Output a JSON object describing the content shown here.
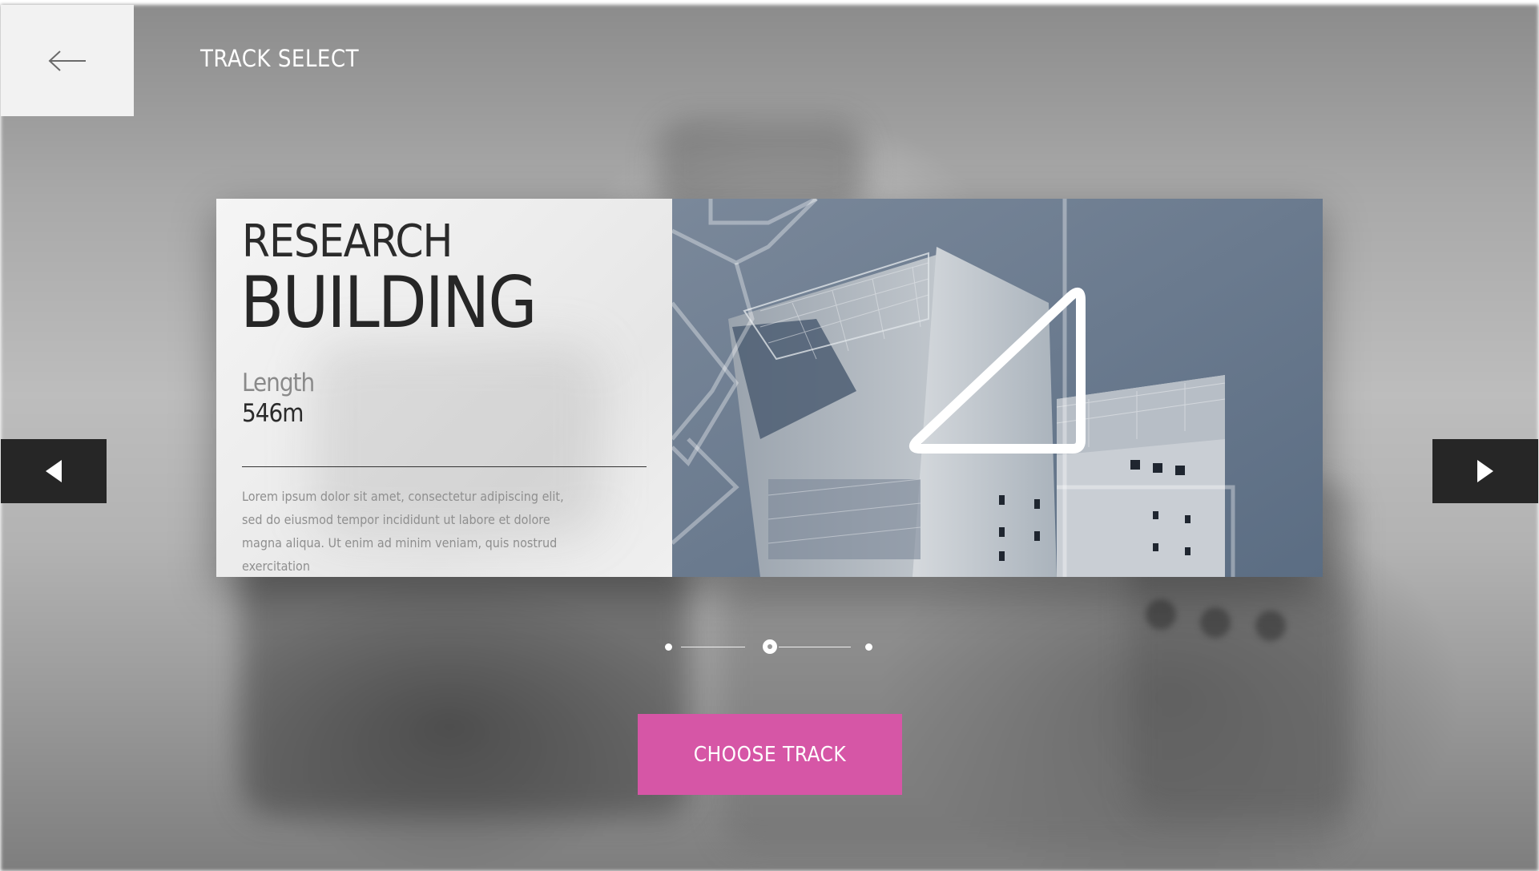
{
  "header": {
    "title": "TRACK SELECT",
    "back_icon": "arrow-left-icon"
  },
  "track": {
    "subtitle": "RESEARCH",
    "name": "BUILDING",
    "length_label": "Length",
    "length_value": "546m",
    "description": "Lorem ipsum dolor sit amet, consectetur adipiscing elit, sed do eiusmod tempor incididunt ut labore et dolore magna aliqua. Ut enim ad minim veniam, quis nostrud exercitation",
    "map_icon": "track-layout-icon"
  },
  "navigation": {
    "prev_icon": "triangle-left-icon",
    "next_icon": "triangle-right-icon"
  },
  "pager": {
    "count": 3,
    "active_index": 1
  },
  "actions": {
    "choose_label": "CHOOSE TRACK"
  },
  "colors": {
    "accent": "#d656a6",
    "panel_dark": "#262626",
    "panel_light": "#f2f2f2",
    "text_dark": "#2b2b2b",
    "text_muted": "#8f8f8f"
  }
}
